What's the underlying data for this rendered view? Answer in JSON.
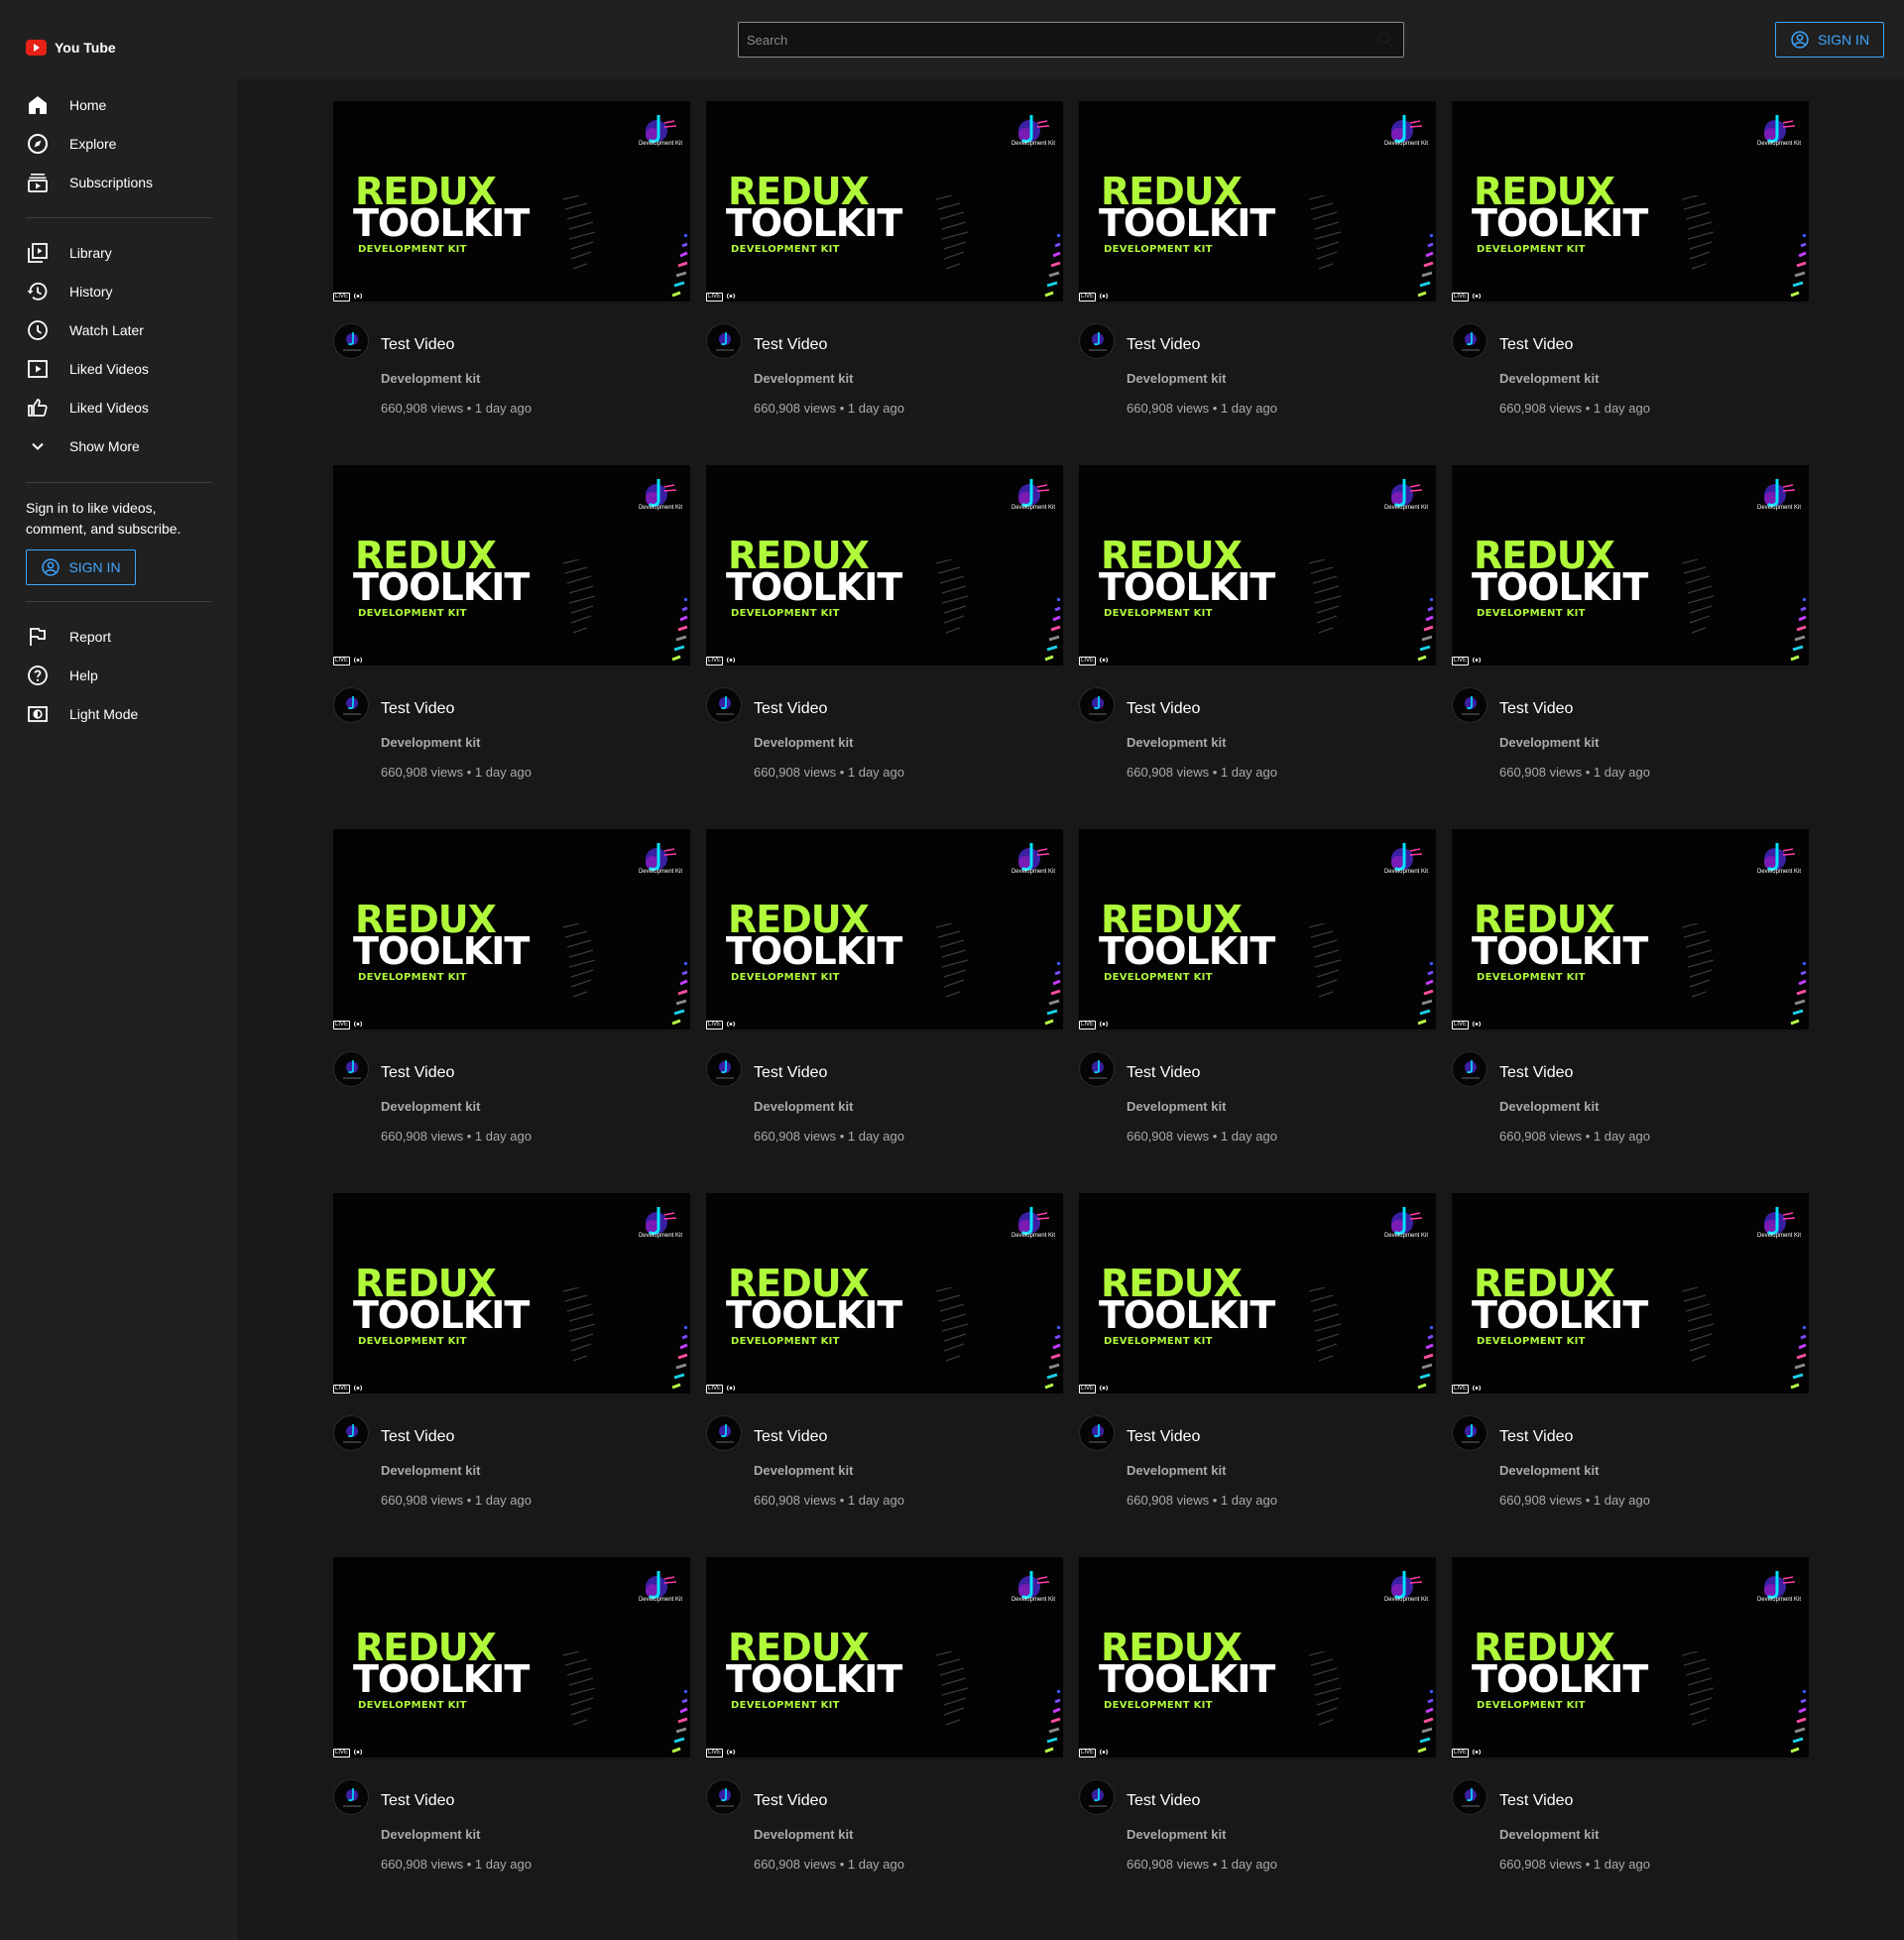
{
  "logo": {
    "text": "You Tube"
  },
  "search": {
    "placeholder": "Search"
  },
  "header": {
    "sign_in": "SIGN IN"
  },
  "sidebar": {
    "primary": [
      {
        "label": "Home",
        "icon": "home-icon"
      },
      {
        "label": "Explore",
        "icon": "compass-icon"
      },
      {
        "label": "Subscriptions",
        "icon": "subscriptions-icon"
      }
    ],
    "secondary": [
      {
        "label": "Library",
        "icon": "library-icon"
      },
      {
        "label": "History",
        "icon": "history-icon"
      },
      {
        "label": "Watch Later",
        "icon": "clock-icon"
      },
      {
        "label": "Liked Videos",
        "icon": "play-box-icon"
      },
      {
        "label": "Liked Videos",
        "icon": "thumb-up-icon"
      },
      {
        "label": "Show More",
        "icon": "chevron-down-icon"
      }
    ],
    "signin_prompt": "Sign in to like videos, comment, and subscribe.",
    "sign_in": "SIGN IN",
    "footer": [
      {
        "label": "Report",
        "icon": "flag-icon"
      },
      {
        "label": "Help",
        "icon": "help-icon"
      },
      {
        "label": "Light Mode",
        "icon": "theme-toggle-icon"
      }
    ]
  },
  "thumbnail": {
    "line1": "REDUX",
    "line2": "TOOLKIT",
    "line3": "DEVELOPMENT KIT",
    "brand": "Development Kit",
    "live_badge": "LIVE"
  },
  "videos": [
    {
      "title": "Test Video",
      "channel": "Development kit",
      "meta": "660,908 views • 1 day ago"
    },
    {
      "title": "Test Video",
      "channel": "Development kit",
      "meta": "660,908 views • 1 day ago"
    },
    {
      "title": "Test Video",
      "channel": "Development kit",
      "meta": "660,908 views • 1 day ago"
    },
    {
      "title": "Test Video",
      "channel": "Development kit",
      "meta": "660,908 views • 1 day ago"
    },
    {
      "title": "Test Video",
      "channel": "Development kit",
      "meta": "660,908 views • 1 day ago"
    },
    {
      "title": "Test Video",
      "channel": "Development kit",
      "meta": "660,908 views • 1 day ago"
    },
    {
      "title": "Test Video",
      "channel": "Development kit",
      "meta": "660,908 views • 1 day ago"
    },
    {
      "title": "Test Video",
      "channel": "Development kit",
      "meta": "660,908 views • 1 day ago"
    },
    {
      "title": "Test Video",
      "channel": "Development kit",
      "meta": "660,908 views • 1 day ago"
    },
    {
      "title": "Test Video",
      "channel": "Development kit",
      "meta": "660,908 views • 1 day ago"
    },
    {
      "title": "Test Video",
      "channel": "Development kit",
      "meta": "660,908 views • 1 day ago"
    },
    {
      "title": "Test Video",
      "channel": "Development kit",
      "meta": "660,908 views • 1 day ago"
    },
    {
      "title": "Test Video",
      "channel": "Development kit",
      "meta": "660,908 views • 1 day ago"
    },
    {
      "title": "Test Video",
      "channel": "Development kit",
      "meta": "660,908 views • 1 day ago"
    },
    {
      "title": "Test Video",
      "channel": "Development kit",
      "meta": "660,908 views • 1 day ago"
    },
    {
      "title": "Test Video",
      "channel": "Development kit",
      "meta": "660,908 views • 1 day ago"
    },
    {
      "title": "Test Video",
      "channel": "Development kit",
      "meta": "660,908 views • 1 day ago"
    },
    {
      "title": "Test Video",
      "channel": "Development kit",
      "meta": "660,908 views • 1 day ago"
    },
    {
      "title": "Test Video",
      "channel": "Development kit",
      "meta": "660,908 views • 1 day ago"
    },
    {
      "title": "Test Video",
      "channel": "Development kit",
      "meta": "660,908 views • 1 day ago"
    }
  ],
  "colors": {
    "background": "#181818",
    "surface": "#202020",
    "accent_blue": "#3ea6ff",
    "brand_red": "#e62117",
    "thumb_green": "#aff93a"
  }
}
